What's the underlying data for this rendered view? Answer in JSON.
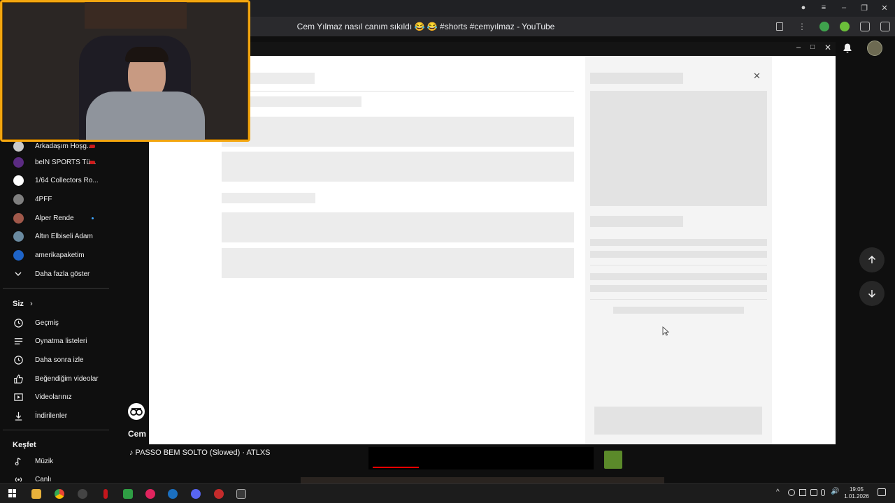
{
  "browser": {
    "page_title": "Cem Yılmaz nasıl canım sıkıldı 😂 😂 #shorts #cemyılmaz - YouTube"
  },
  "sidebar": {
    "subscriptions": [
      {
        "label": "Arkadaşım Hoşg...",
        "color": "#c9c9c9",
        "badge": "live"
      },
      {
        "label": "beIN SPORTS Tü...",
        "color": "#5b2b82",
        "badge": "live"
      },
      {
        "label": "1/64 Collectors Ro...",
        "color": "#ffffff",
        "badge": ""
      },
      {
        "label": "4PFF",
        "color": "#7f7f7f",
        "badge": ""
      },
      {
        "label": "Alper Rende",
        "color": "#a0584a",
        "badge": "new"
      },
      {
        "label": "Altın Elbiseli Adam",
        "color": "#6a8aa0",
        "badge": ""
      },
      {
        "label": "amerikapaketim",
        "color": "#1e64c8",
        "badge": ""
      }
    ],
    "show_more": "Daha fazla göster",
    "you_header": "Siz",
    "you_items": [
      {
        "label": "Geçmiş",
        "icon": "history-icon"
      },
      {
        "label": "Oynatma listeleri",
        "icon": "playlist-icon"
      },
      {
        "label": "Daha sonra izle",
        "icon": "clock-icon"
      },
      {
        "label": "Beğendiğim videolar",
        "icon": "thumbs-up-icon"
      },
      {
        "label": "Videolarınız",
        "icon": "video-icon"
      },
      {
        "label": "İndirilenler",
        "icon": "download-icon"
      }
    ],
    "explore_header": "Keşfet",
    "explore_items": [
      {
        "label": "Müzik",
        "icon": "music-icon"
      },
      {
        "label": "Canlı",
        "icon": "live-icon"
      }
    ]
  },
  "video": {
    "channel_name_partial": "Cem",
    "song": "♪ PASSO BEM SOLTO (Slowed) · ATLXS"
  },
  "taskbar": {
    "time": "19:05",
    "date": "1.01.2026"
  },
  "colors": {
    "webcam_border": "#f2a50f",
    "background": "#0f0f0f",
    "skeleton": "#ececec"
  }
}
